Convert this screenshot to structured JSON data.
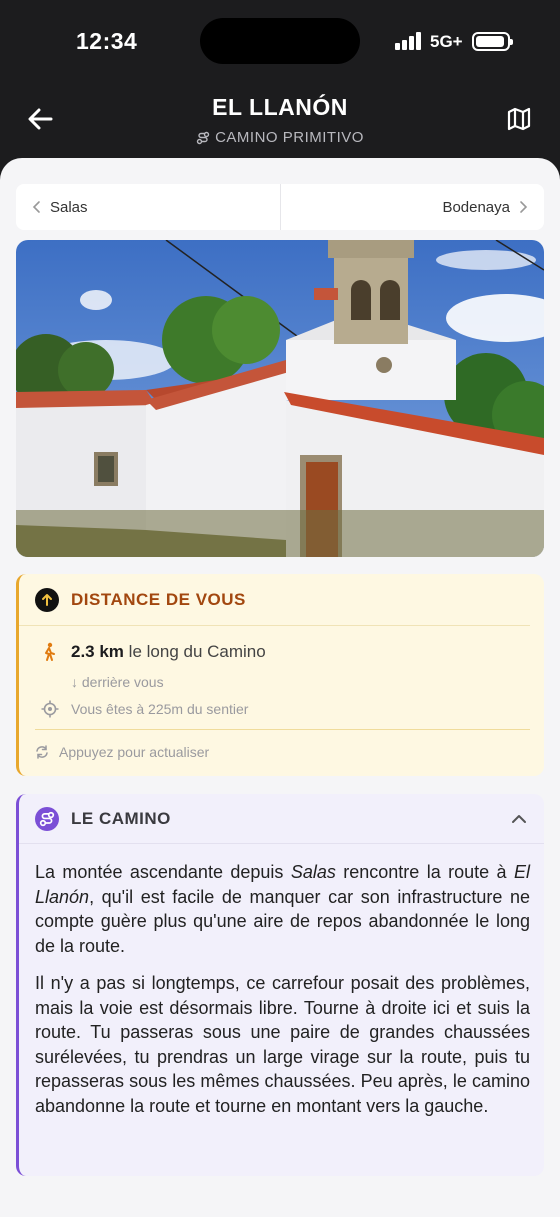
{
  "status": {
    "time": "12:34",
    "network": "5G+"
  },
  "header": {
    "title": "EL LLANÓN",
    "subtitle": "CAMINO PRIMITIVO"
  },
  "nav": {
    "prev": "Salas",
    "next": "Bodenaya"
  },
  "distance": {
    "title": "DISTANCE DE VOUS",
    "value": "2.3 km",
    "value_suffix": "le long du Camino",
    "behind": "↓ derrière vous",
    "trail": "Vous êtes à 225m du sentier",
    "refresh": "Appuyez pour actualiser"
  },
  "camino": {
    "title": "LE CAMINO",
    "p1_a": "La montée ascendante depuis ",
    "p1_salas": "Salas",
    "p1_b": " rencontre la route à ",
    "p1_llanon": "El Llanón",
    "p1_c": ", qu'il est facile de manquer car son infrastructure ne compte guère plus qu'une aire de repos abandonnée le long de la route.",
    "p2": "Il n'y a pas si longtemps, ce carrefour posait des problèmes, mais la voie est désormais libre. Tourne à droite ici et suis la route. Tu passeras sous une paire de grandes chaussées surélevées, tu prendras un large virage sur la route, puis tu repasseras sous les mêmes chaussées. Peu après, le camino abandonne la route et tourne en montant vers la gauche."
  },
  "colors": {
    "accent_distance": "#e8a72c",
    "accent_camino": "#7b4fd6",
    "distance_title": "#a2470f"
  }
}
